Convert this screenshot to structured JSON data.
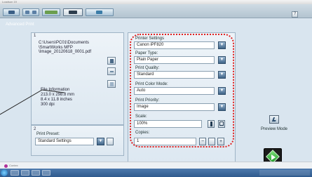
{
  "window": {
    "title": "Loadsun 19"
  },
  "toolbar": {
    "tabs": [
      {
        "name": "scan-tab-icon"
      },
      {
        "name": "copy-tab-icon"
      },
      {
        "name": "fax-tab-icon"
      },
      {
        "name": "print-tab-icon"
      },
      {
        "name": "share-tab-icon"
      }
    ],
    "help": "?"
  },
  "main": {
    "section_title": "Advanced Print",
    "panel1": {
      "number": "1",
      "path_lines": [
        "C:\\Users\\PC01\\Documents",
        "\\SmartWorks MFP",
        "\\Image_20120618_0001.pdf"
      ],
      "file_info_title": "File Information",
      "file_info": [
        "213.0 x 298.8 mm",
        "8.4 x 11.8 inches",
        "300 dpi"
      ]
    },
    "panel2": {
      "number": "2",
      "preset_label": "Print Preset:",
      "preset_value": "Standard Settings"
    },
    "settings": {
      "printer_label": "Printer Settings",
      "printer_value": "Canon iPF820",
      "paper_label": "Paper Type:",
      "paper_value": "Plain Paper",
      "quality_label": "Print Quality:",
      "quality_value": "Standard",
      "color_label": "Print Color Mode:",
      "color_value": "Auto",
      "priority_label": "Print Priority:",
      "priority_value": "Image",
      "scale_label": "Scale:",
      "scale_value": "100%",
      "copies_label": "Copies:",
      "copies_value": "1",
      "minus": "−",
      "plus": "+"
    },
    "preview_label": "Preview Mode"
  },
  "status": {
    "logo_text": "Contex"
  },
  "colors": {
    "highlight": "#e02020",
    "panel": "#d9e5ef",
    "taskbar": "#3a6698",
    "start_green": "#1f9a2a"
  }
}
